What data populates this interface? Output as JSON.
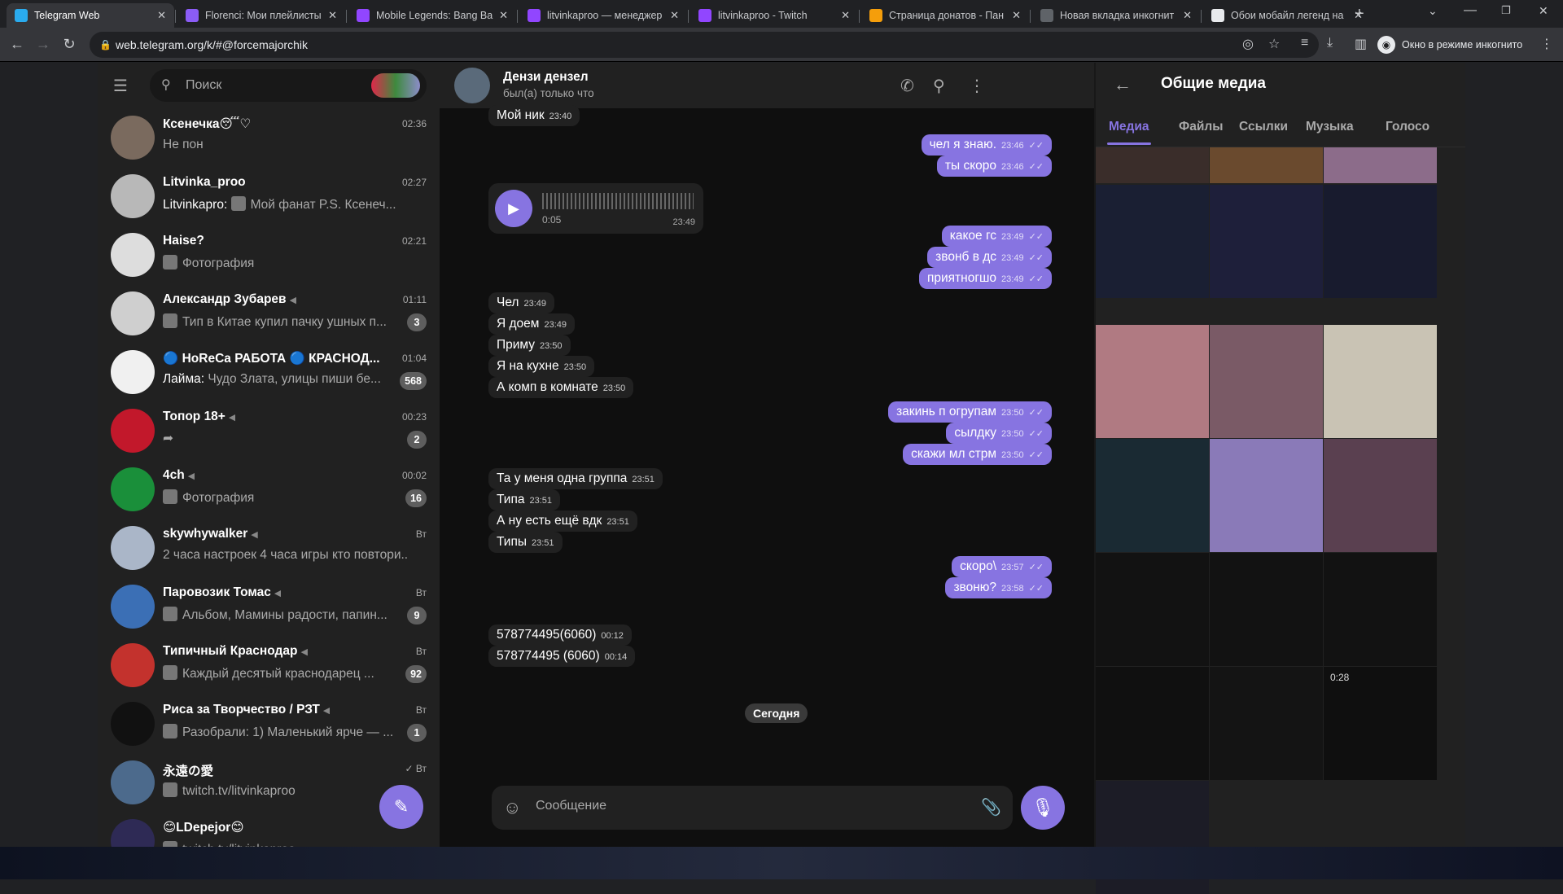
{
  "browser": {
    "tabs": [
      {
        "title": "Telegram Web",
        "fav": "telegram",
        "color": "#2aabee"
      },
      {
        "title": "Florenci: Мои плейлисты",
        "fav": "II",
        "color": "#8b5cf6"
      },
      {
        "title": "Mobile Legends: Bang Ba",
        "fav": "twitch",
        "color": "#9146ff"
      },
      {
        "title": "litvinkaproo — менеджер",
        "fav": "twitch",
        "color": "#9146ff"
      },
      {
        "title": "litvinkaproo - Twitch",
        "fav": "twitch",
        "color": "#9146ff"
      },
      {
        "title": "Страница донатов - Пан",
        "fav": "D",
        "color": "#f59e0b"
      },
      {
        "title": "Новая вкладка инкогнит",
        "fav": "incognito",
        "color": "#5f6368"
      },
      {
        "title": "Обои мобайл легенд на",
        "fav": "doc",
        "color": "#e8eaed"
      }
    ],
    "url": "web.telegram.org/k/#@forcemajorchik",
    "incognito_label": "Окно в режиме инкогнито"
  },
  "sidebar": {
    "search_placeholder": "Поиск",
    "chats": [
      {
        "name": "Ксенечка😴♡",
        "time": "02:36",
        "preview": "Не пон",
        "sender": "",
        "badge": "",
        "avatar_color": "#7a6a5e"
      },
      {
        "name": "Litvinka_proo",
        "time": "02:27",
        "preview": "Мой фанат P.S. Ксенеч...",
        "sender": "Litvinkapro:",
        "badge": "",
        "avatar_color": "#b8b8b8"
      },
      {
        "name": "Haise?",
        "time": "02:21",
        "preview": "Фотография",
        "sender": "",
        "badge": "",
        "avatar_color": "#ddd"
      },
      {
        "name": "Александр Зубарев",
        "time": "01:11",
        "preview": "Тип в Китае купил пачку ушных п...",
        "sender": "",
        "badge": "3",
        "avatar_color": "#cfcfcf"
      },
      {
        "name": "🔵 HoReCa РАБОТА 🔵 КРАСНОД...",
        "time": "01:04",
        "preview": "Чудо Злата, улицы пиши бе...",
        "sender": "Лайма:",
        "badge": "568",
        "avatar_color": "#f0f0f0"
      },
      {
        "name": "Топор 18+",
        "time": "00:23",
        "preview": "",
        "sender": "",
        "badge": "2",
        "avatar_color": "#c2182b"
      },
      {
        "name": "4ch",
        "time": "00:02",
        "preview": "Фотография",
        "sender": "",
        "badge": "16",
        "avatar_color": "#1a8f3a"
      },
      {
        "name": "skywhywalker",
        "time": "Вт",
        "preview": "2 часа настроек 4 часа игры кто повтори...",
        "sender": "",
        "badge": "",
        "avatar_color": "#aab6c8"
      },
      {
        "name": "Паровозик Томас",
        "time": "Вт",
        "preview": "Альбом, Мамины радости, папин...",
        "sender": "",
        "badge": "9",
        "avatar_color": "#3b6fb5"
      },
      {
        "name": "Типичный Краснодар",
        "time": "Вт",
        "preview": "Каждый десятый краснодарец ...",
        "sender": "",
        "badge": "92",
        "avatar_color": "#c3322d"
      },
      {
        "name": "Риса за Творчество / РЗТ",
        "time": "Вт",
        "preview": "Разобрали: 1) Маленький ярче — ...",
        "sender": "",
        "badge": "1",
        "avatar_color": "#111"
      },
      {
        "name": "永遠の愛",
        "time": "✓ Вт",
        "preview": "twitch.tv/litvinkaproo",
        "sender": "",
        "badge": "",
        "avatar_color": "#4c6a8c"
      },
      {
        "name": "😊LDepejor😊",
        "time": "",
        "preview": "twitch.tv/litvinkaproo",
        "sender": "",
        "badge": "",
        "avatar_color": "#2e2a55"
      }
    ]
  },
  "chat": {
    "title": "Дензи дензел",
    "status": "был(а) только что",
    "voice": {
      "duration": "0:05",
      "time": "23:49"
    },
    "messages": [
      {
        "text": "Мой ник",
        "time": "23:40",
        "dir": "in"
      },
      {
        "text": "чел я знаю.",
        "time": "23:46",
        "dir": "out"
      },
      {
        "text": "ты скоро",
        "time": "23:46",
        "dir": "out"
      },
      {
        "text": "какое гс",
        "time": "23:49",
        "dir": "out"
      },
      {
        "text": "звонб в дс",
        "time": "23:49",
        "dir": "out"
      },
      {
        "text": "приятногшо",
        "time": "23:49",
        "dir": "out"
      },
      {
        "text": "Чел",
        "time": "23:49",
        "dir": "in"
      },
      {
        "text": "Я доем",
        "time": "23:49",
        "dir": "in"
      },
      {
        "text": "Приму",
        "time": "23:50",
        "dir": "in"
      },
      {
        "text": "Я на кухне",
        "time": "23:50",
        "dir": "in"
      },
      {
        "text": "А комп в комнате",
        "time": "23:50",
        "dir": "in"
      },
      {
        "text": "закинь п огрупам",
        "time": "23:50",
        "dir": "out"
      },
      {
        "text": "сылдку",
        "time": "23:50",
        "dir": "out"
      },
      {
        "text": "скажи мл стрм",
        "time": "23:50",
        "dir": "out"
      },
      {
        "text": "Та у меня одна группа",
        "time": "23:51",
        "dir": "in"
      },
      {
        "text": "Типа",
        "time": "23:51",
        "dir": "in"
      },
      {
        "text": "А ну есть ещё вдк",
        "time": "23:51",
        "dir": "in"
      },
      {
        "text": "Типы",
        "time": "23:51",
        "dir": "in"
      },
      {
        "text": "скоро\\",
        "time": "23:57",
        "dir": "out"
      },
      {
        "text": "звоню?",
        "time": "23:58",
        "dir": "out"
      },
      {
        "text": "578774495(6060)",
        "time": "00:12",
        "dir": "in"
      },
      {
        "text": "578774495 (6060)",
        "time": "00:14",
        "dir": "in"
      }
    ],
    "date_divider": "Сегодня",
    "composer_placeholder": "Сообщение"
  },
  "media_panel": {
    "title": "Общие медиа",
    "tabs": [
      "Медиа",
      "Файлы",
      "Ссылки",
      "Музыка",
      "Голосо"
    ],
    "video_duration": "0:28",
    "thumb_colors": [
      "#3a2d2a",
      "#6a4a2e",
      "#8c6c8a",
      "#1a1f33",
      "#1e1f3a",
      "#181b2e",
      "#b07a82",
      "#7a5a66",
      "#c9c3b4",
      "#1a2a33",
      "#8a7ab8",
      "#5a4050",
      "#121212",
      "#121212",
      "#121212",
      "#101010",
      "#141414",
      "#0f0f0f",
      "#1c1c26"
    ]
  },
  "colors": {
    "accent": "#8774e1",
    "panel": "#212121",
    "bg": "#0f0f0f"
  }
}
